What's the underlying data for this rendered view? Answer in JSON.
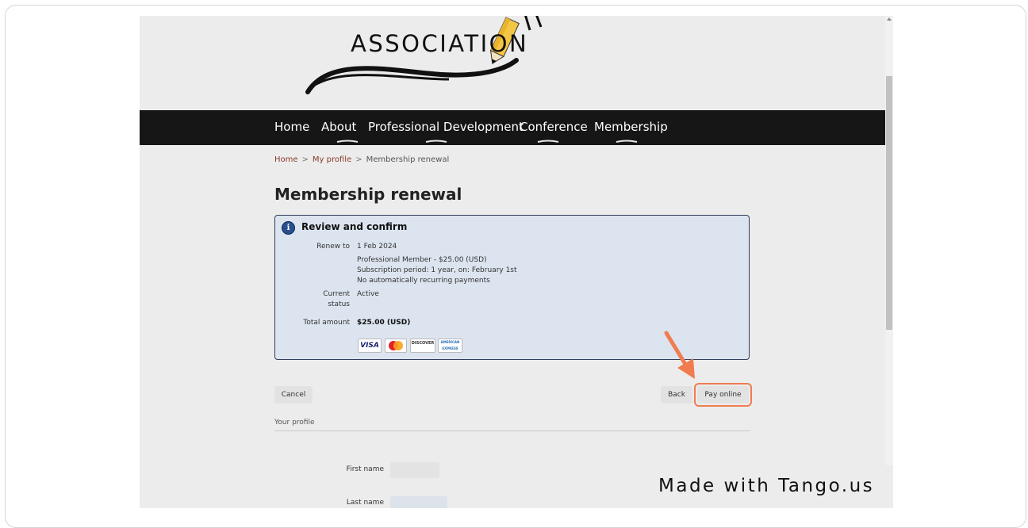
{
  "site": {
    "logo_text": "ASSOCIATION"
  },
  "nav": {
    "items": [
      {
        "label": "Home"
      },
      {
        "label": "About"
      },
      {
        "label": "Professional Development"
      },
      {
        "label": "Conference"
      },
      {
        "label": "Membership"
      }
    ],
    "underline_color": "#e6e6e6"
  },
  "breadcrumb": {
    "home": "Home",
    "sep1": ">",
    "profile": "My profile",
    "sep2": ">",
    "current": "Membership renewal"
  },
  "page": {
    "title": "Membership renewal"
  },
  "review": {
    "heading": "Review and confirm",
    "icon": "info-icon",
    "renew_to_label": "Renew to",
    "renew_to_value": "1 Feb 2024",
    "plan": "Professional Member - $25.00 (USD)",
    "subscription": "Subscription period: 1 year, on: February 1st",
    "recurring": "No automatically recurring payments",
    "status_label_1": "Current",
    "status_label_2": "status",
    "status_value": "Active",
    "total_label": "Total amount",
    "total_value": "$25.00 (USD)",
    "cards": [
      {
        "name": "visa-card-icon",
        "label": "VISA"
      },
      {
        "name": "mastercard-icon",
        "label": "MasterCard"
      },
      {
        "name": "discover-card-icon",
        "label": "DISCOVER"
      },
      {
        "name": "amex-card-icon",
        "label": "AMERICAN EXPRESS"
      }
    ]
  },
  "actions": {
    "cancel": "Cancel",
    "back": "Back",
    "pay": "Pay online"
  },
  "profile": {
    "section_label": "Your profile",
    "first_name_label": "First name",
    "last_name_label": "Last name"
  },
  "watermark": {
    "text": "Made with Tango.us"
  },
  "colors": {
    "nav_bg": "#161616",
    "panel_bg": "#dce4ef",
    "panel_border": "#2f3e5c",
    "highlight": "#f07c4f",
    "link": "#8a3b2a"
  }
}
